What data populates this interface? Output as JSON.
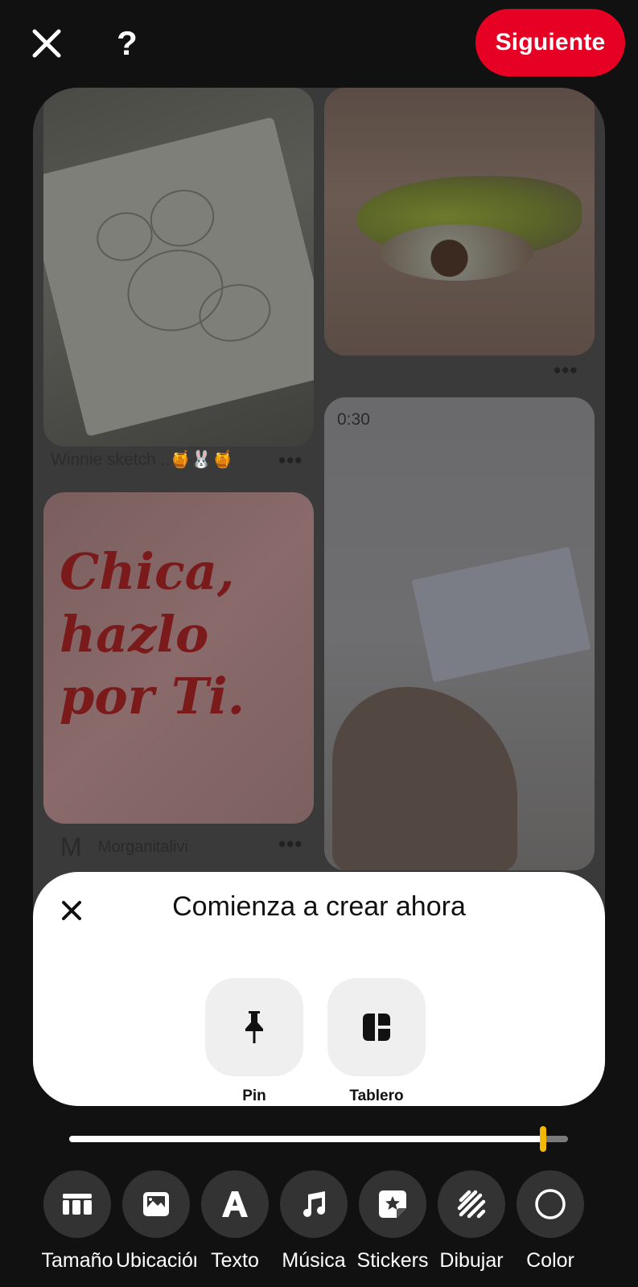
{
  "header": {
    "next_label": "Siguiente"
  },
  "preview": {
    "pins": [
      {
        "caption": "Winnie sketch ..🍯🐰🍯",
        "more": "•••"
      },
      {
        "more": "•••"
      },
      {
        "author_initial": "M",
        "author_name": "Morganitalivi",
        "more": "•••",
        "artwork_text": "Chica, hazlo por Ti."
      },
      {
        "duration": "0:30"
      }
    ]
  },
  "sheet": {
    "title": "Comienza a crear ahora",
    "options": [
      {
        "label": "Pin",
        "icon": "pushpin-icon"
      },
      {
        "label": "Tablero",
        "icon": "board-layout-icon"
      }
    ]
  },
  "timeline": {
    "progress": 0.95
  },
  "tools": [
    {
      "label": "Tamaño",
      "icon": "resize-icon"
    },
    {
      "label": "Ubicación",
      "icon": "image-placement-icon"
    },
    {
      "label": "Texto",
      "icon": "text-A-icon"
    },
    {
      "label": "Música",
      "icon": "music-note-icon"
    },
    {
      "label": "Stickers",
      "icon": "sticker-star-icon"
    },
    {
      "label": "Dibujar",
      "icon": "scribble-icon"
    },
    {
      "label": "Color",
      "icon": "circle-icon"
    }
  ],
  "colors": {
    "background": "#111111",
    "accent_red": "#e60023",
    "slider_handle": "#f5b800",
    "sheet_bg": "#ffffff",
    "tool_circle": "#333333"
  }
}
